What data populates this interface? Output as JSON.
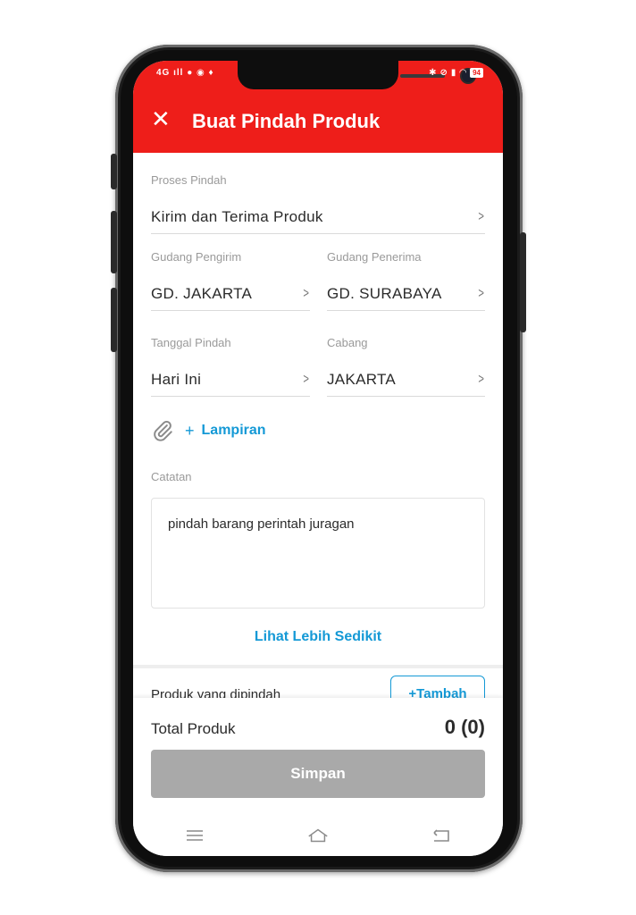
{
  "status_bar": {
    "left": "4G ıll ● ◉ ♦",
    "right_icons": [
      "bluetooth-icon",
      "mute-icon",
      "signal-icon",
      "wifi-icon"
    ],
    "battery": "94"
  },
  "header": {
    "title": "Buat Pindah Produk",
    "close_icon": "close-icon"
  },
  "form": {
    "process": {
      "label": "Proses Pindah",
      "value": "Kirim dan Terima Produk"
    },
    "sender_warehouse": {
      "label": "Gudang Pengirim",
      "value": "GD. JAKARTA"
    },
    "receiver_warehouse": {
      "label": "Gudang Penerima",
      "value": "GD. SURABAYA"
    },
    "transfer_date": {
      "label": "Tanggal Pindah",
      "value": "Hari Ini"
    },
    "branch": {
      "label": "Cabang",
      "value": "JAKARTA"
    },
    "attachment": {
      "plus": "+",
      "label": "Lampiran"
    },
    "notes": {
      "label": "Catatan",
      "value": "pindah barang perintah juragan"
    },
    "show_less": "Lihat Lebih Sedikit"
  },
  "products": {
    "label": "Produk yang dipindah",
    "add_button": "+Tambah"
  },
  "footer": {
    "total_label": "Total Produk",
    "total_value": "0 (0)",
    "save_button": "Simpan"
  },
  "colors": {
    "brand_red": "#ee1e1a",
    "link_blue": "#1499d6",
    "disabled_gray": "#a9a9a9"
  }
}
